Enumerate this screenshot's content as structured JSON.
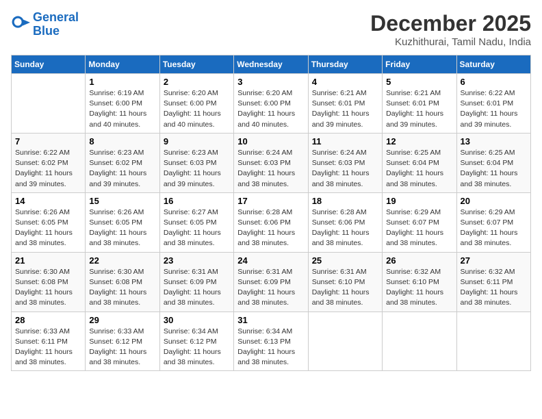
{
  "header": {
    "logo_line1": "General",
    "logo_line2": "Blue",
    "month_title": "December 2025",
    "location": "Kuzhithurai, Tamil Nadu, India"
  },
  "weekdays": [
    "Sunday",
    "Monday",
    "Tuesday",
    "Wednesday",
    "Thursday",
    "Friday",
    "Saturday"
  ],
  "weeks": [
    [
      {
        "day": "",
        "info": ""
      },
      {
        "day": "1",
        "info": "Sunrise: 6:19 AM\nSunset: 6:00 PM\nDaylight: 11 hours\nand 40 minutes."
      },
      {
        "day": "2",
        "info": "Sunrise: 6:20 AM\nSunset: 6:00 PM\nDaylight: 11 hours\nand 40 minutes."
      },
      {
        "day": "3",
        "info": "Sunrise: 6:20 AM\nSunset: 6:00 PM\nDaylight: 11 hours\nand 40 minutes."
      },
      {
        "day": "4",
        "info": "Sunrise: 6:21 AM\nSunset: 6:01 PM\nDaylight: 11 hours\nand 39 minutes."
      },
      {
        "day": "5",
        "info": "Sunrise: 6:21 AM\nSunset: 6:01 PM\nDaylight: 11 hours\nand 39 minutes."
      },
      {
        "day": "6",
        "info": "Sunrise: 6:22 AM\nSunset: 6:01 PM\nDaylight: 11 hours\nand 39 minutes."
      }
    ],
    [
      {
        "day": "7",
        "info": "Sunrise: 6:22 AM\nSunset: 6:02 PM\nDaylight: 11 hours\nand 39 minutes."
      },
      {
        "day": "8",
        "info": "Sunrise: 6:23 AM\nSunset: 6:02 PM\nDaylight: 11 hours\nand 39 minutes."
      },
      {
        "day": "9",
        "info": "Sunrise: 6:23 AM\nSunset: 6:03 PM\nDaylight: 11 hours\nand 39 minutes."
      },
      {
        "day": "10",
        "info": "Sunrise: 6:24 AM\nSunset: 6:03 PM\nDaylight: 11 hours\nand 38 minutes."
      },
      {
        "day": "11",
        "info": "Sunrise: 6:24 AM\nSunset: 6:03 PM\nDaylight: 11 hours\nand 38 minutes."
      },
      {
        "day": "12",
        "info": "Sunrise: 6:25 AM\nSunset: 6:04 PM\nDaylight: 11 hours\nand 38 minutes."
      },
      {
        "day": "13",
        "info": "Sunrise: 6:25 AM\nSunset: 6:04 PM\nDaylight: 11 hours\nand 38 minutes."
      }
    ],
    [
      {
        "day": "14",
        "info": "Sunrise: 6:26 AM\nSunset: 6:05 PM\nDaylight: 11 hours\nand 38 minutes."
      },
      {
        "day": "15",
        "info": "Sunrise: 6:26 AM\nSunset: 6:05 PM\nDaylight: 11 hours\nand 38 minutes."
      },
      {
        "day": "16",
        "info": "Sunrise: 6:27 AM\nSunset: 6:05 PM\nDaylight: 11 hours\nand 38 minutes."
      },
      {
        "day": "17",
        "info": "Sunrise: 6:28 AM\nSunset: 6:06 PM\nDaylight: 11 hours\nand 38 minutes."
      },
      {
        "day": "18",
        "info": "Sunrise: 6:28 AM\nSunset: 6:06 PM\nDaylight: 11 hours\nand 38 minutes."
      },
      {
        "day": "19",
        "info": "Sunrise: 6:29 AM\nSunset: 6:07 PM\nDaylight: 11 hours\nand 38 minutes."
      },
      {
        "day": "20",
        "info": "Sunrise: 6:29 AM\nSunset: 6:07 PM\nDaylight: 11 hours\nand 38 minutes."
      }
    ],
    [
      {
        "day": "21",
        "info": "Sunrise: 6:30 AM\nSunset: 6:08 PM\nDaylight: 11 hours\nand 38 minutes."
      },
      {
        "day": "22",
        "info": "Sunrise: 6:30 AM\nSunset: 6:08 PM\nDaylight: 11 hours\nand 38 minutes."
      },
      {
        "day": "23",
        "info": "Sunrise: 6:31 AM\nSunset: 6:09 PM\nDaylight: 11 hours\nand 38 minutes."
      },
      {
        "day": "24",
        "info": "Sunrise: 6:31 AM\nSunset: 6:09 PM\nDaylight: 11 hours\nand 38 minutes."
      },
      {
        "day": "25",
        "info": "Sunrise: 6:31 AM\nSunset: 6:10 PM\nDaylight: 11 hours\nand 38 minutes."
      },
      {
        "day": "26",
        "info": "Sunrise: 6:32 AM\nSunset: 6:10 PM\nDaylight: 11 hours\nand 38 minutes."
      },
      {
        "day": "27",
        "info": "Sunrise: 6:32 AM\nSunset: 6:11 PM\nDaylight: 11 hours\nand 38 minutes."
      }
    ],
    [
      {
        "day": "28",
        "info": "Sunrise: 6:33 AM\nSunset: 6:11 PM\nDaylight: 11 hours\nand 38 minutes."
      },
      {
        "day": "29",
        "info": "Sunrise: 6:33 AM\nSunset: 6:12 PM\nDaylight: 11 hours\nand 38 minutes."
      },
      {
        "day": "30",
        "info": "Sunrise: 6:34 AM\nSunset: 6:12 PM\nDaylight: 11 hours\nand 38 minutes."
      },
      {
        "day": "31",
        "info": "Sunrise: 6:34 AM\nSunset: 6:13 PM\nDaylight: 11 hours\nand 38 minutes."
      },
      {
        "day": "",
        "info": ""
      },
      {
        "day": "",
        "info": ""
      },
      {
        "day": "",
        "info": ""
      }
    ]
  ]
}
